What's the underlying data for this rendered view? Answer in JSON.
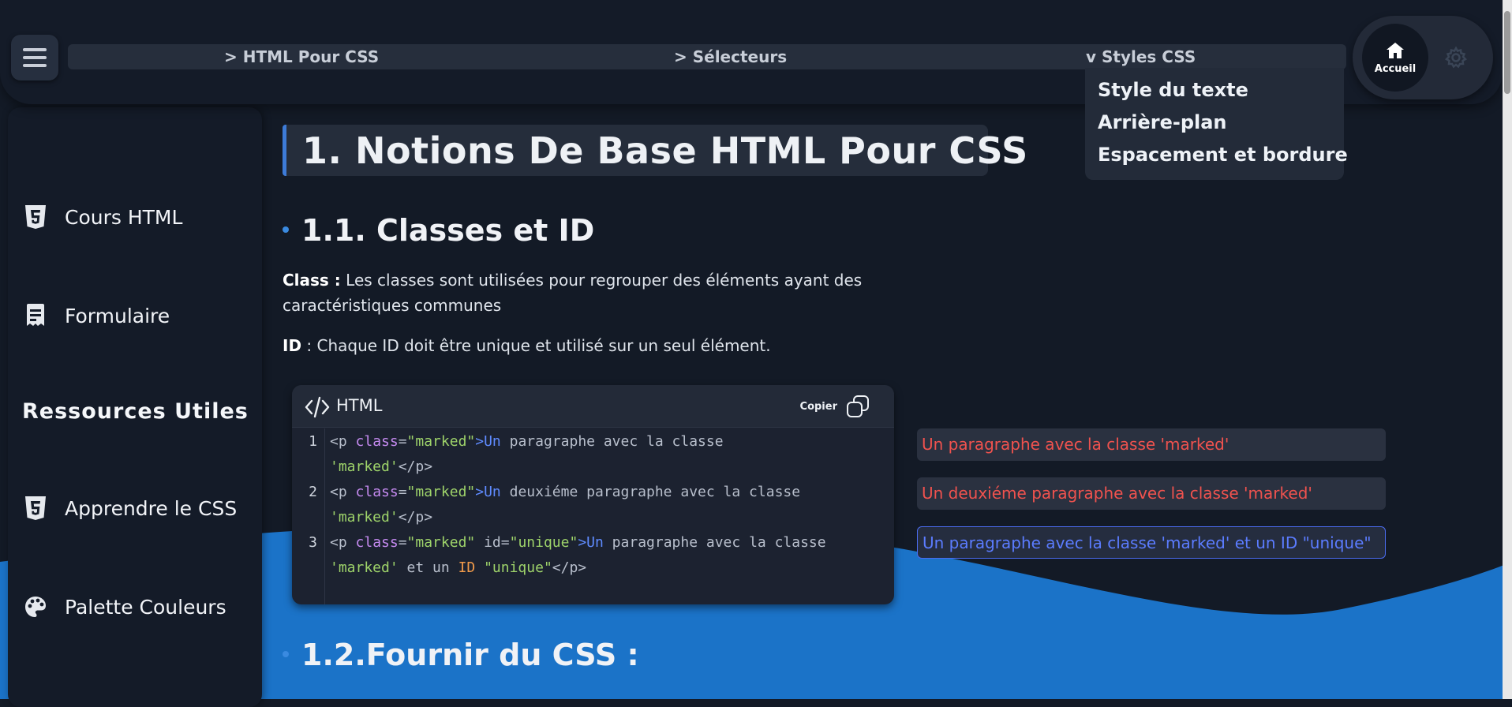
{
  "header": {
    "breadcrumbs": [
      {
        "label": "> HTML Pour CSS"
      },
      {
        "label": "> Sélecteurs"
      },
      {
        "label": "v Styles CSS"
      }
    ],
    "dropdown_items": [
      {
        "label": "Style du texte"
      },
      {
        "label": "Arrière-plan"
      },
      {
        "label": "Espacement et bordure"
      }
    ],
    "home_label": "Accueil",
    "icons": {
      "menu": "hamburger-icon",
      "home": "home-icon",
      "settings": "gear-icon"
    }
  },
  "sidebar": {
    "items": [
      {
        "label": "Cours HTML",
        "icon": "html5-icon"
      },
      {
        "label": "Formulaire",
        "icon": "form-icon"
      }
    ],
    "section_title": "Ressources Utiles",
    "resources": [
      {
        "label": "Apprendre le CSS",
        "icon": "css3-icon"
      },
      {
        "label": "Palette Couleurs",
        "icon": "palette-icon"
      }
    ]
  },
  "main": {
    "title": "1. Notions De Base HTML Pour CSS",
    "section1": {
      "title": "1.1. Classes et ID",
      "class_label": "Class :",
      "class_text": " Les classes sont utilisées pour regrouper des éléments ayant des caractéristiques communes",
      "id_label": "ID",
      "id_text": " : Chaque ID doit être unique et utilisé sur un seul élément."
    },
    "code": {
      "language": "HTML",
      "copy_label": "Copier",
      "line_numbers": [
        "1",
        "2",
        "3"
      ],
      "lines": [
        {
          "a1": "<p ",
          "a2": "class",
          "a3": "=",
          "a4": "\"marked\"",
          "a5": ">",
          "a6": "Un",
          "a7": " paragraphe avec la classe",
          "b1": "'marked'",
          "b2": "</p>"
        },
        {
          "a1": "<p ",
          "a2": "class",
          "a3": "=",
          "a4": "\"marked\"",
          "a5": ">",
          "a6": "Un",
          "a7": " deuxiéme paragraphe avec la classe",
          "b1": "'marked'",
          "b2": "</p>"
        },
        {
          "a1": "<p ",
          "a2": "class",
          "a3": "=",
          "a4": "\"marked\"",
          "a5": " id=",
          "a6": "\"unique\"",
          "a7": ">",
          "a8": "Un",
          "a9": " paragraphe avec la classe",
          "b1": "'marked'",
          "b2": " et un ",
          "b3": "ID",
          "b4": " \"unique\"",
          "b5": "</p>"
        }
      ]
    },
    "demos": [
      {
        "text": "Un paragraphe avec la classe 'marked'"
      },
      {
        "text": "Un deuxiéme paragraphe avec la classe 'marked'"
      },
      {
        "text": "Un paragraphe avec la classe 'marked' et un ID \"unique\""
      }
    ],
    "section2": {
      "title": "1.2.Fournir du CSS :"
    }
  },
  "colors": {
    "background": "#131a26",
    "panel": "#141b28",
    "accent_blue": "#1f74c9",
    "demo_red": "#f0524e",
    "demo_blue": "#5b7cff"
  }
}
